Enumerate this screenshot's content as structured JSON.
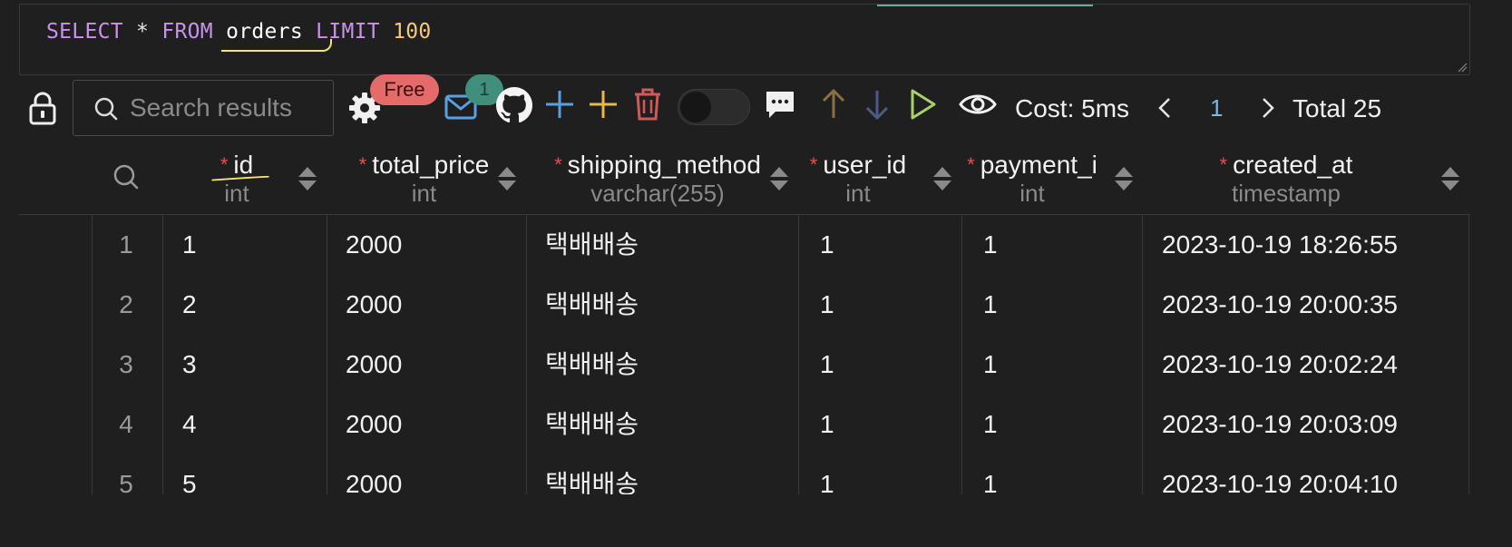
{
  "query": {
    "kw_select": "SELECT",
    "star": "*",
    "kw_from": "FROM",
    "table": "orders",
    "kw_limit": "LIMIT",
    "limit": "100"
  },
  "toolbar": {
    "search_placeholder": "Search results",
    "free_badge": "Free",
    "notification_count": "1",
    "cost": "Cost: 5ms",
    "page": "1",
    "total": "Total 25"
  },
  "icons": [
    "lock-icon",
    "search-icon",
    "gear-icon",
    "mail-icon",
    "github-icon",
    "plus-icon",
    "plus-icon",
    "trash-icon",
    "toggle",
    "comment-icon",
    "arrow-up-icon",
    "arrow-down-icon",
    "play-icon",
    "eye-icon",
    "chevron-left-icon",
    "chevron-right-icon"
  ],
  "colors": {
    "keyword": "#c792ea",
    "number": "#f2c97d",
    "required": "#e05252",
    "free_badge": "#e56a6a",
    "count_badge": "#3f8f7c",
    "page_number": "#7ab8e8"
  },
  "columns": [
    {
      "name": "id",
      "type": "int"
    },
    {
      "name": "total_price",
      "type": "int"
    },
    {
      "name": "shipping_method",
      "type": "varchar(255)"
    },
    {
      "name": "user_id",
      "type": "int"
    },
    {
      "name": "payment_i",
      "type": "int"
    },
    {
      "name": "created_at",
      "type": "timestamp"
    }
  ],
  "rows": [
    {
      "n": "1",
      "cells": [
        "1",
        "2000",
        "택배배송",
        "1",
        "1",
        "2023-10-19 18:26:55"
      ]
    },
    {
      "n": "2",
      "cells": [
        "2",
        "2000",
        "택배배송",
        "1",
        "1",
        "2023-10-19 20:00:35"
      ]
    },
    {
      "n": "3",
      "cells": [
        "3",
        "2000",
        "택배배송",
        "1",
        "1",
        "2023-10-19 20:02:24"
      ]
    },
    {
      "n": "4",
      "cells": [
        "4",
        "2000",
        "택배배송",
        "1",
        "1",
        "2023-10-19 20:03:09"
      ]
    },
    {
      "n": "5",
      "cells": [
        "5",
        "2000",
        "택배배송",
        "1",
        "1",
        "2023-10-19 20:04:10"
      ]
    }
  ]
}
